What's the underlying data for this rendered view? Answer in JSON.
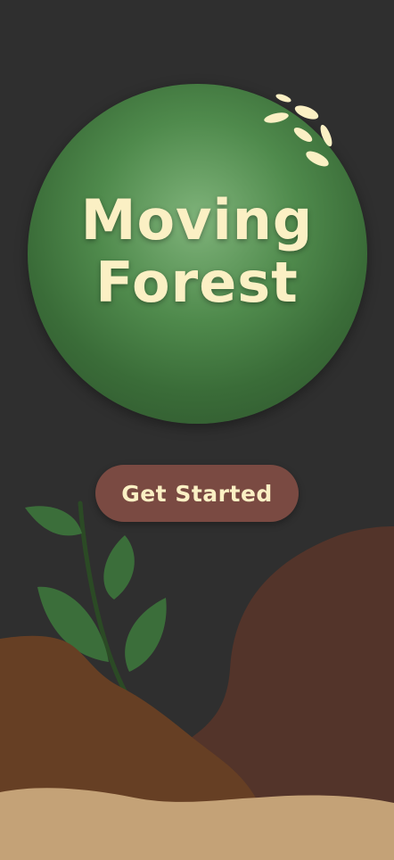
{
  "hero": {
    "title_line1": "Moving",
    "title_line2": "Forest"
  },
  "cta": {
    "label": "Get Started"
  },
  "colors": {
    "background": "#2f2f2f",
    "title": "#fbf0c4",
    "button": "#7a4a42",
    "leaf": "#3b6e3a",
    "hill_dark": "#53342a",
    "hill_mid": "#663f24",
    "sand": "#c4a277"
  },
  "icons": {
    "seeds": "seeds-icon",
    "plant": "sprout-icon"
  }
}
